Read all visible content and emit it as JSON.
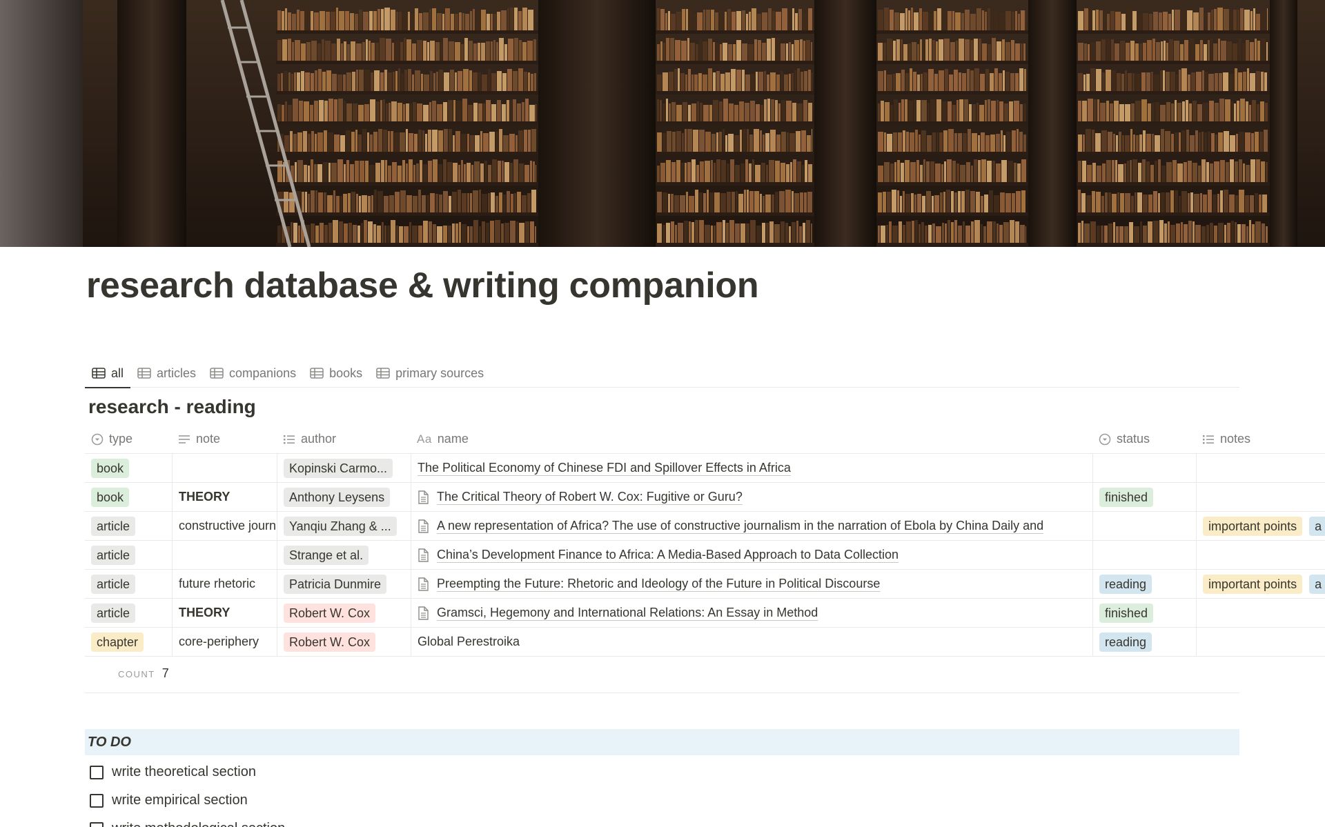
{
  "page": {
    "title": "research database & writing companion"
  },
  "tabs": [
    {
      "label": "all",
      "active": true
    },
    {
      "label": "articles",
      "active": false
    },
    {
      "label": "companions",
      "active": false
    },
    {
      "label": "books",
      "active": false
    },
    {
      "label": "primary sources",
      "active": false
    }
  ],
  "database": {
    "title": "research - reading",
    "columns": {
      "type": "type",
      "note": "note",
      "author": "author",
      "name_prefix": "Aa",
      "name": "name",
      "status": "status",
      "notes": "notes"
    },
    "rows": [
      {
        "type": "book",
        "note": "",
        "author": "Kopinski Carmo...",
        "name": "The Political Economy of Chinese FDI and Spillover Effects in Africa",
        "status": "",
        "notes": ""
      },
      {
        "type": "book",
        "note": "THEORY",
        "author": "Anthony Leysens",
        "name": "The Critical Theory of Robert W. Cox: Fugitive or Guru?",
        "status": "finished",
        "notes": ""
      },
      {
        "type": "article",
        "note": "constructive journ",
        "author": "Yanqiu Zhang & ...",
        "name": "A new representation of Africa? The use of constructive journalism in the narration of Ebola by China Daily and",
        "status": "",
        "notes": "important points"
      },
      {
        "type": "article",
        "note": "",
        "author": "Strange et al.",
        "name": "China’s Development Finance to Africa: A Media-Based Approach to Data Collection",
        "status": "",
        "notes": ""
      },
      {
        "type": "article",
        "note": "future rhetoric",
        "author": "Patricia Dunmire",
        "name": "Preempting the Future: Rhetoric and Ideology of the Future in Political Discourse",
        "status": "reading",
        "notes": "important points"
      },
      {
        "type": "article",
        "note": "THEORY",
        "author": "Robert W. Cox",
        "name": "Gramsci, Hegemony and International Relations: An Essay in Method",
        "status": "finished",
        "notes": ""
      },
      {
        "type": "chapter",
        "note": "core-periphery",
        "author": "Robert W. Cox",
        "name": "Global Perestroika",
        "status": "reading",
        "notes": ""
      }
    ],
    "overflow_tag": "a",
    "count_label": "COUNT",
    "count_value": "7"
  },
  "todo": {
    "heading": "TO DO",
    "items": [
      {
        "label": "write theoretical section",
        "checked": false
      },
      {
        "label": "write empirical section",
        "checked": false
      },
      {
        "label": "write methodological section",
        "checked": false
      }
    ]
  },
  "colors": {
    "text": "#37352f",
    "muted": "#787774",
    "tag_green": "#dbeddb",
    "tag_gray": "#e9e9e7",
    "tag_yellow": "#fbecc8",
    "tag_red": "#ffe2dd",
    "tag_blue": "#d3e5ef",
    "callout_blue": "#e7f3f8"
  },
  "icons": {
    "tab": "table-icon",
    "type_column": "select-icon",
    "note_column": "text-icon",
    "author_column": "multi-select-icon",
    "status_column": "status-icon",
    "notes_column": "multi-select-icon",
    "row_page": "document-icon"
  }
}
